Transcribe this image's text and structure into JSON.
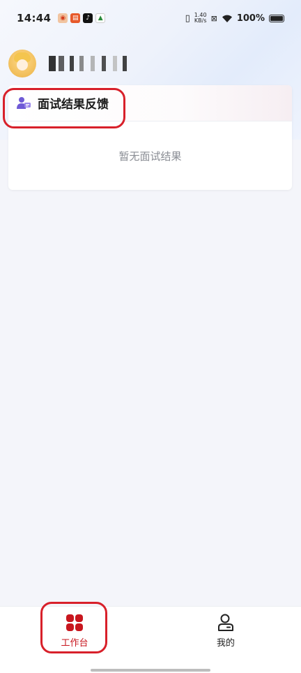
{
  "status_bar": {
    "time": "14:44",
    "net_speed_value": "1.40",
    "net_speed_unit": "KB/s",
    "battery": "100%"
  },
  "header": {
    "username": ""
  },
  "card": {
    "title": "面试结果反馈",
    "empty_text": "暂无面试结果"
  },
  "nav": {
    "items": [
      {
        "label": "工作台",
        "active": true
      },
      {
        "label": "我的",
        "active": false
      }
    ]
  },
  "colors": {
    "accent": "#c8161e",
    "highlight": "#d8202a",
    "card_icon": "#6f5ad6"
  }
}
